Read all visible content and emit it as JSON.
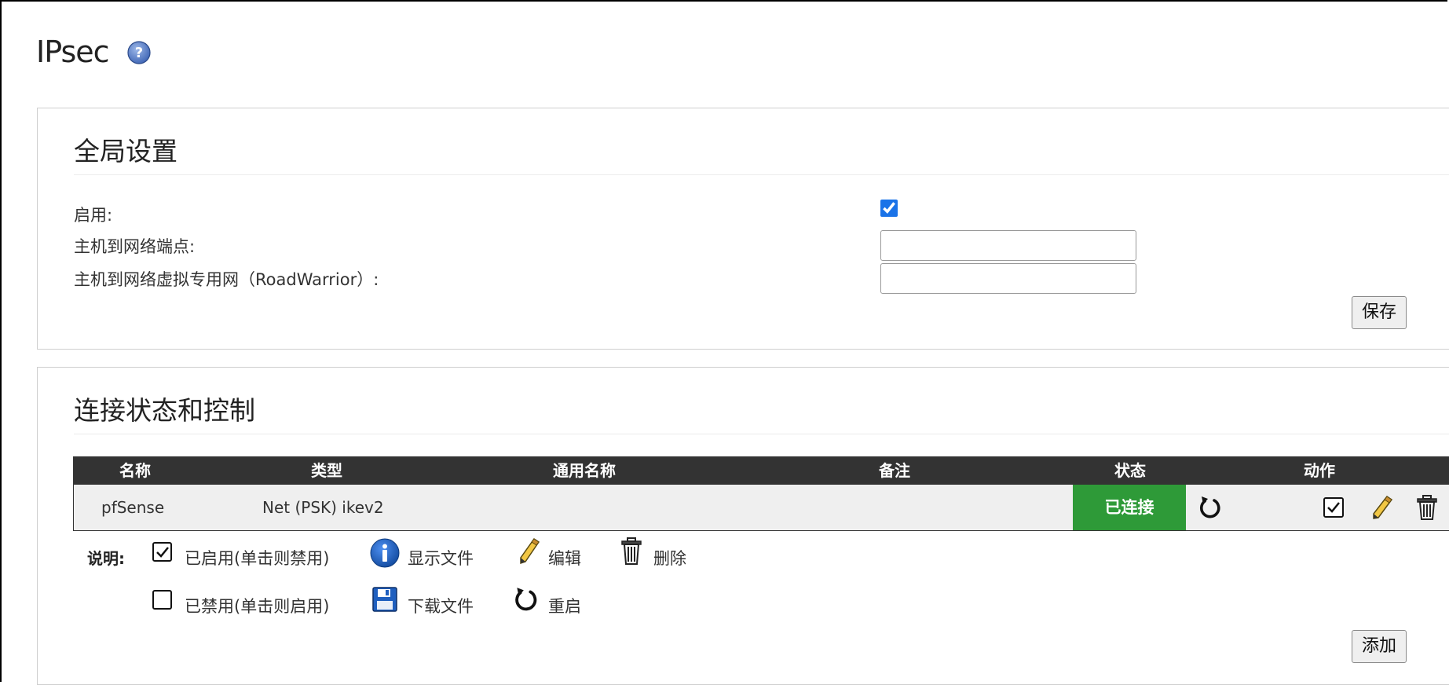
{
  "page": {
    "title": "IPsec",
    "help_icon": "question-circle-icon"
  },
  "global_settings": {
    "heading": "全局设置",
    "enable_label": "启用:",
    "enable_checked": true,
    "host_endpoint_label": "主机到网络端点:",
    "host_endpoint_value": "",
    "roadwarrior_label": "主机到网络虚拟专用网（RoadWarrior）:",
    "roadwarrior_value": "",
    "save_label": "保存"
  },
  "connections": {
    "heading": "连接状态和控制",
    "columns": [
      "名称",
      "类型",
      "通用名称",
      "备注",
      "状态",
      "动作"
    ],
    "rows": [
      {
        "name": "pfSense",
        "type": "Net (PSK) ikev2",
        "common_name": "",
        "comment": "",
        "status": "已连接"
      }
    ],
    "add_label": "添加"
  },
  "legend": {
    "title": "说明:",
    "enabled": "已启用(单击则禁用)",
    "disabled": "已禁用(单击则启用)",
    "show_file": "显示文件",
    "download_file": "下载文件",
    "edit": "编辑",
    "restart": "重启",
    "delete": "删除"
  },
  "colors": {
    "status_connected": "#2e9a38",
    "table_header": "#333333",
    "row_bg": "#efefef",
    "info_blue": "#1f5fbf"
  }
}
